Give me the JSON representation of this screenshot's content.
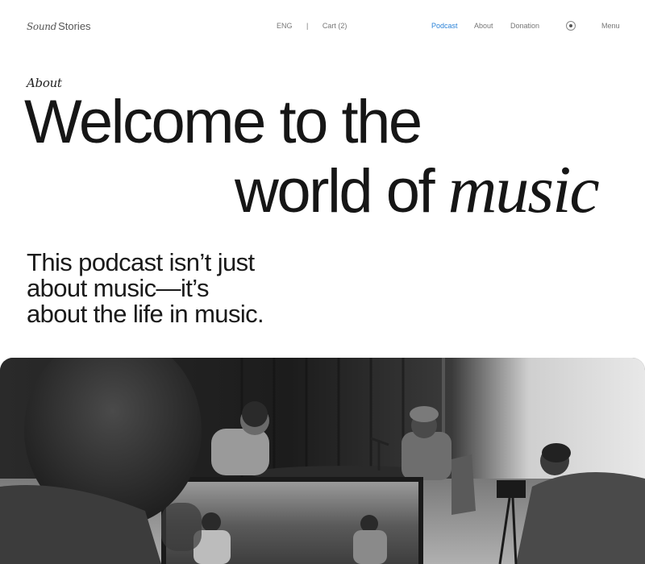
{
  "header": {
    "brand_italic": "Sound",
    "brand_plain": "Stories",
    "language": "ENG",
    "separator": "|",
    "cart": "Cart (2)",
    "nav": {
      "podcast": "Podcast",
      "about": "About",
      "donation": "Donation",
      "menu": "Menu"
    },
    "accent_color": "#2b83d8"
  },
  "hero": {
    "eyebrow": "About",
    "headline_line1": "Welcome to the",
    "headline_line2_plain": "world of ",
    "headline_line2_italic": "music",
    "intro_line1": "This podcast isn’t just",
    "intro_line2": "about music—it’s",
    "intro_line3": "about the life in music."
  },
  "media": {
    "image": "podcast-studio-photo",
    "icons": [
      "record-icon"
    ]
  }
}
